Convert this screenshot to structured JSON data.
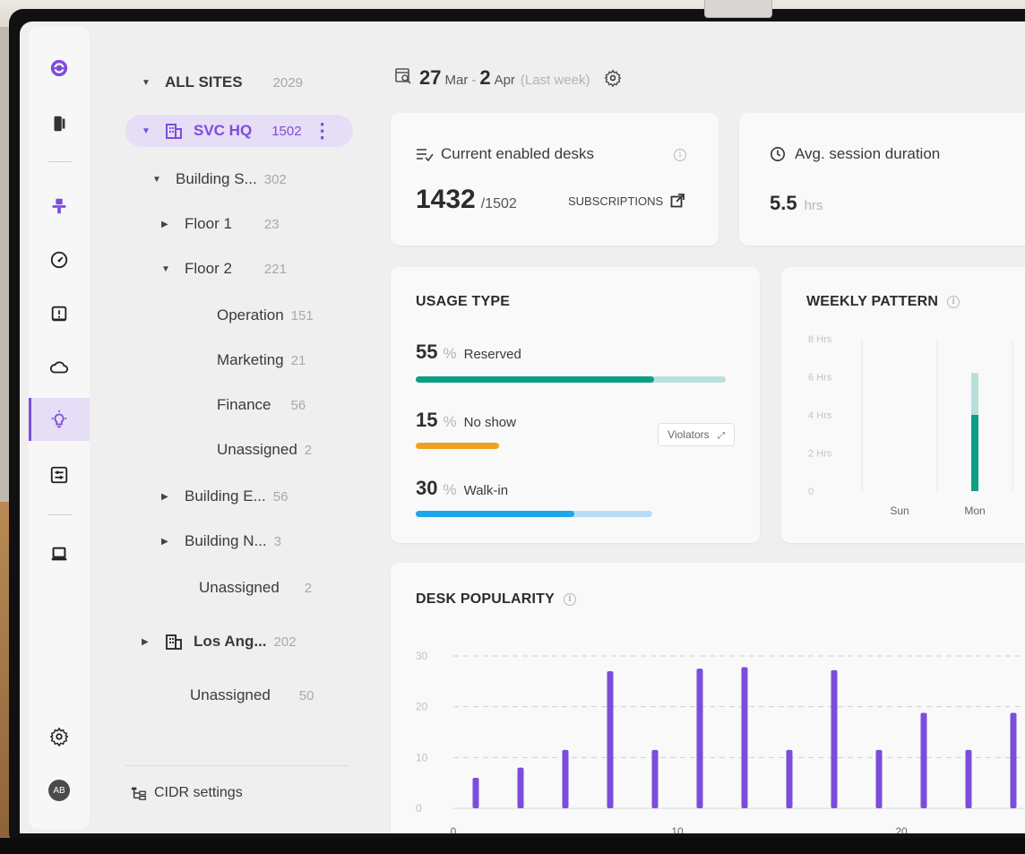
{
  "colors": {
    "accent": "#7c4ddb",
    "reserved": "#0e9e86",
    "reserved_track": "#b8e0da",
    "noshow": "#f0a020",
    "walkin": "#1ea7e8",
    "walkin_track": "#b5def4"
  },
  "rail": {
    "icons": [
      "logo-icon",
      "door-icon",
      "podium-icon",
      "speedometer-icon",
      "alert-icon",
      "cloud-icon",
      "lightbulb-icon",
      "sliders-icon",
      "laptop-icon",
      "gear-icon"
    ],
    "avatar": "AB"
  },
  "tree": {
    "all_sites": {
      "label": "ALL SITES",
      "count": "2029"
    },
    "svc_hq": {
      "label": "SVC HQ",
      "count": "1502"
    },
    "building_s": {
      "label": "Building S...",
      "count": "302"
    },
    "floor1": {
      "label": "Floor 1",
      "count": "23"
    },
    "floor2": {
      "label": "Floor 2",
      "count": "221"
    },
    "operation": {
      "label": "Operation",
      "count": "151"
    },
    "marketing": {
      "label": "Marketing",
      "count": "21"
    },
    "finance": {
      "label": "Finance",
      "count": "56"
    },
    "unassigned_floor": {
      "label": "Unassigned",
      "count": "2"
    },
    "building_e": {
      "label": "Building E...",
      "count": "56"
    },
    "building_n": {
      "label": "Building N...",
      "count": "3"
    },
    "unassigned_site": {
      "label": "Unassigned",
      "count": "2"
    },
    "los_ang": {
      "label": "Los Ang...",
      "count": "202"
    },
    "unassigned_all": {
      "label": "Unassigned",
      "count": "50"
    },
    "cidr": "CIDR settings"
  },
  "header": {
    "day_start": "27",
    "month_start": "Mar",
    "dash": "-",
    "day_end": "2",
    "month_end": "Apr",
    "period": "(Last week)"
  },
  "enabled_desks": {
    "title": "Current enabled desks",
    "value": "1432",
    "total": "/1502",
    "subscriptions": "SUBSCRIPTIONS"
  },
  "session": {
    "title": "Avg. session duration",
    "value": "5.5",
    "unit": "hrs"
  },
  "usage": {
    "title": "USAGE TYPE",
    "rows": [
      {
        "pct": "55",
        "sign": "%",
        "label": "Reserved",
        "fill": 0.77
      },
      {
        "pct": "15",
        "sign": "%",
        "label": "No show",
        "fill": 0.27
      },
      {
        "pct": "30",
        "sign": "%",
        "label": "Walk-in",
        "fill": 0.67
      }
    ],
    "violators": "Violators"
  },
  "weekly": {
    "title": "WEEKLY PATTERN",
    "yticks": [
      "8 Hrs",
      "6 Hrs",
      "4 Hrs",
      "2 Hrs",
      "0"
    ],
    "days": [
      "Sun",
      "Mon"
    ]
  },
  "chart_data": [
    {
      "type": "bar",
      "title": "WEEKLY PATTERN",
      "categories": [
        "Sun",
        "Mon"
      ],
      "series": [
        {
          "values": [
            0,
            4.0
          ]
        },
        {
          "values": [
            0,
            6.2
          ]
        }
      ],
      "ylim": [
        0,
        8
      ]
    },
    {
      "type": "bar",
      "title": "DESK POPULARITY",
      "x": [
        1,
        3,
        5,
        7,
        9,
        11,
        13,
        15,
        17,
        19,
        21,
        23,
        25
      ],
      "values": [
        6,
        8,
        11.5,
        27,
        11.5,
        27.5,
        27.8,
        11.5,
        27.2,
        11.5,
        18.8,
        11.5,
        18.8
      ],
      "xticks": [
        "0",
        "10",
        "20"
      ],
      "yticks": [
        "30",
        "20",
        "10",
        "0"
      ],
      "xlim": [
        0,
        26
      ],
      "ylim": [
        0,
        30
      ],
      "grid": true
    }
  ],
  "popularity": {
    "title": "DESK POPULARITY"
  }
}
